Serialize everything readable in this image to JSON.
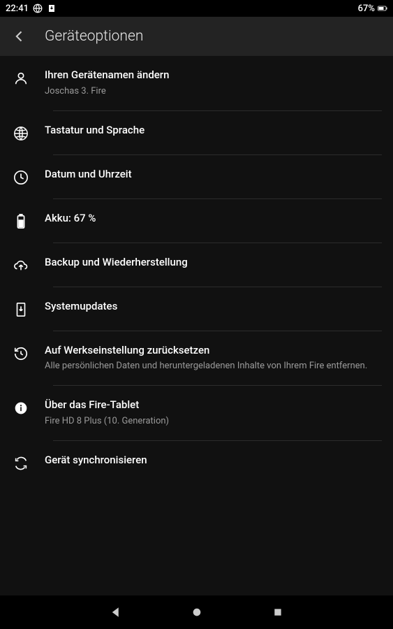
{
  "status": {
    "time": "22:41",
    "battery_pct": "67%"
  },
  "header": {
    "title": "Geräteoptionen"
  },
  "items": [
    {
      "title": "Ihren Gerätenamen ändern",
      "sub": "Joschas 3. Fire"
    },
    {
      "title": "Tastatur und Sprache",
      "sub": ""
    },
    {
      "title": "Datum und Uhrzeit",
      "sub": ""
    },
    {
      "title": "Akku: 67 %",
      "sub": ""
    },
    {
      "title": "Backup und Wiederherstellung",
      "sub": ""
    },
    {
      "title": "Systemupdates",
      "sub": ""
    },
    {
      "title": "Auf Werkseinstellung zurücksetzen",
      "sub": "Alle persönlichen Daten und heruntergeladenen Inhalte von Ihrem Fire entfernen."
    },
    {
      "title": "Über das Fire-Tablet",
      "sub": "Fire HD 8 Plus (10. Generation)"
    },
    {
      "title": "Gerät synchronisieren",
      "sub": ""
    }
  ]
}
